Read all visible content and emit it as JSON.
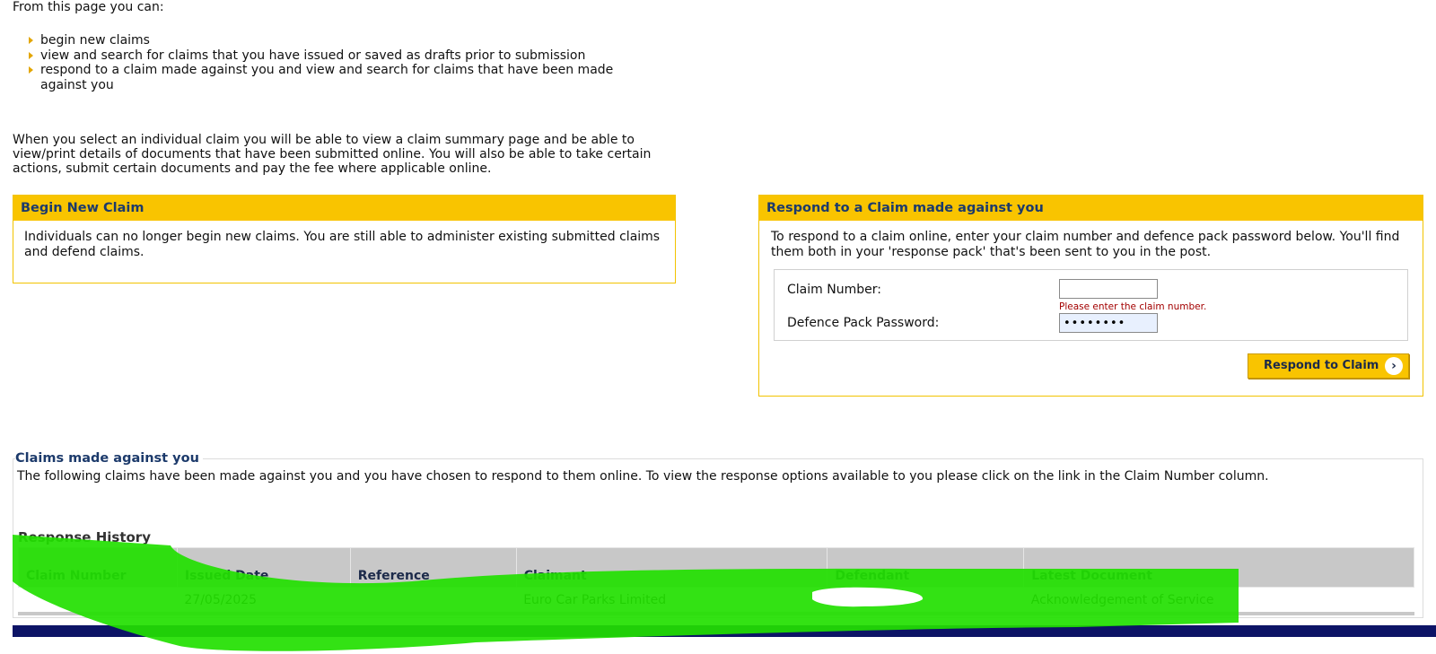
{
  "intro": {
    "lead": "From this page you can:",
    "bullets": [
      "begin new claims",
      "view and search for claims that you have issued or saved as drafts prior to submission",
      "respond to a claim made against you and view and search for claims that have been made against you"
    ],
    "paragraph": "When you select an individual claim you will be able to view a claim summary page and be able to view/print details of documents that have been submitted online. You will also be able to take certain actions, submit certain documents and pay the fee where applicable online."
  },
  "begin_claim": {
    "title": "Begin New Claim",
    "text": "Individuals can no longer begin new claims. You are still able to administer existing submitted claims and defend claims."
  },
  "respond": {
    "title": "Respond to a Claim made against you",
    "text": "To respond to a claim online, enter your claim number and defence pack password below. You'll find them both in your 'response pack' that's been sent to you in the post.",
    "claim_number_label": "Claim Number:",
    "claim_number_value": "",
    "claim_number_error": "Please enter the claim number.",
    "password_label": "Defence Pack Password:",
    "password_value": "••••••••",
    "button_label": "Respond to Claim",
    "button_icon": "chevron-right-icon"
  },
  "claims_against": {
    "legend": "Claims made against you",
    "description": "The following claims have been made against you and you have chosen to respond to them online. To view the response options available to you please click on the link in the Claim Number column.",
    "history_title": "Response History",
    "columns": [
      "Claim Number",
      "Issued Date",
      "Reference",
      "Claimant",
      "Defendant",
      "Latest Document"
    ],
    "rows": [
      {
        "claim_number": "",
        "issued_date": "27/05/2025",
        "reference": "",
        "claimant": "Euro Car Parks Limited",
        "defendant": "",
        "latest_document": "Acknowledgement of Service"
      }
    ]
  },
  "colors": {
    "panel_header": "#f9c400",
    "heading_blue": "#1c3a6b",
    "highlight_green": "#22e000",
    "footer_bar": "#0d1466"
  }
}
